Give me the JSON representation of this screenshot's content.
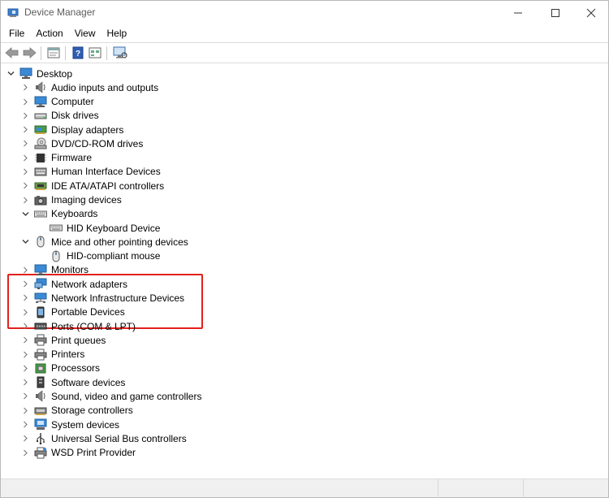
{
  "window": {
    "title": "Device Manager"
  },
  "menu": [
    "File",
    "Action",
    "View",
    "Help"
  ],
  "tree": {
    "root": "Desktop",
    "items": [
      {
        "label": "Audio inputs and outputs",
        "icon": "speaker-icon",
        "expanded": false
      },
      {
        "label": "Computer",
        "icon": "monitor-icon",
        "expanded": false
      },
      {
        "label": "Disk drives",
        "icon": "disk-drive-icon",
        "expanded": false
      },
      {
        "label": "Display adapters",
        "icon": "display-adapter-icon",
        "expanded": false
      },
      {
        "label": "DVD/CD-ROM drives",
        "icon": "dvd-drive-icon",
        "expanded": false
      },
      {
        "label": "Firmware",
        "icon": "chip-icon",
        "expanded": false
      },
      {
        "label": "Human Interface Devices",
        "icon": "hid-icon",
        "expanded": false
      },
      {
        "label": "IDE ATA/ATAPI controllers",
        "icon": "controller-icon",
        "expanded": false
      },
      {
        "label": "Imaging devices",
        "icon": "camera-icon",
        "expanded": false
      },
      {
        "label": "Keyboards",
        "icon": "keyboard-icon",
        "expanded": true,
        "children": [
          {
            "label": "HID Keyboard Device",
            "icon": "keyboard-icon"
          }
        ]
      },
      {
        "label": "Mice and other pointing devices",
        "icon": "mouse-icon",
        "expanded": true,
        "children": [
          {
            "label": "HID-compliant mouse",
            "icon": "mouse-icon"
          }
        ]
      },
      {
        "label": "Monitors",
        "icon": "monitor-icon",
        "expanded": false
      },
      {
        "label": "Network adapters",
        "icon": "network-adapter-icon",
        "expanded": false
      },
      {
        "label": "Network Infrastructure Devices",
        "icon": "network-infrastructure-icon",
        "expanded": false
      },
      {
        "label": "Portable Devices",
        "icon": "portable-device-icon",
        "expanded": false
      },
      {
        "label": "Ports (COM & LPT)",
        "icon": "port-icon",
        "expanded": false
      },
      {
        "label": "Print queues",
        "icon": "printer-icon",
        "expanded": false
      },
      {
        "label": "Printers",
        "icon": "printer-icon",
        "expanded": false
      },
      {
        "label": "Processors",
        "icon": "processor-icon",
        "expanded": false
      },
      {
        "label": "Software devices",
        "icon": "software-device-icon",
        "expanded": false
      },
      {
        "label": "Sound, video and game controllers",
        "icon": "speaker-icon",
        "expanded": false
      },
      {
        "label": "Storage controllers",
        "icon": "storage-controller-icon",
        "expanded": false
      },
      {
        "label": "System devices",
        "icon": "system-device-icon",
        "expanded": false
      },
      {
        "label": "Universal Serial Bus controllers",
        "icon": "usb-icon",
        "expanded": false
      },
      {
        "label": "WSD Print Provider",
        "icon": "wsd-printer-icon",
        "expanded": false
      }
    ]
  },
  "colors": {
    "highlight": "#e3201b",
    "accent": "#1f6fc5"
  }
}
